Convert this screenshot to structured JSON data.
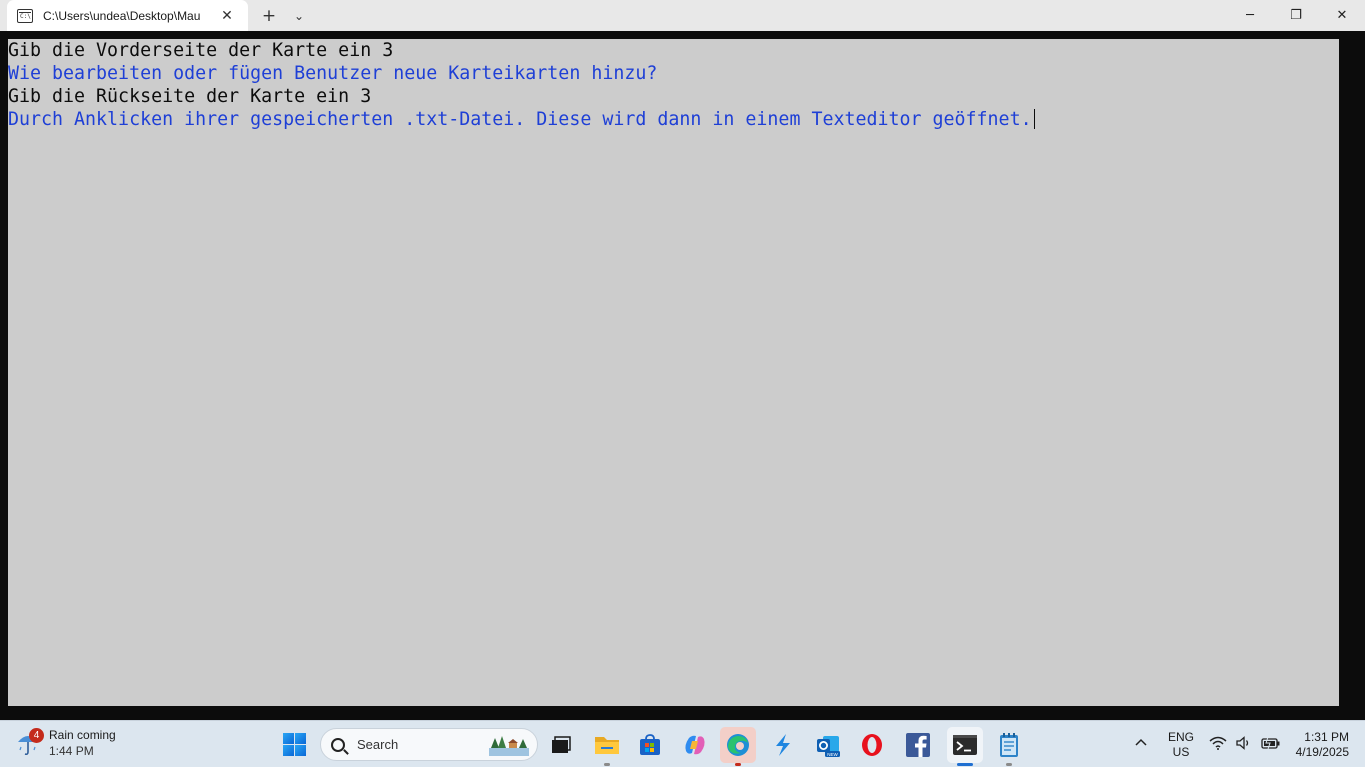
{
  "window": {
    "tab_title": "C:\\Users\\undea\\Desktop\\Mau",
    "tab_icon_text": "C:\\",
    "close_tab_glyph": "✕",
    "new_tab_glyph": "+",
    "dropdown_glyph": "⌄",
    "minimize_glyph": "─",
    "maximize_glyph": "❐",
    "close_glyph": "✕"
  },
  "console": {
    "lines": [
      {
        "text": "Gib die Vorderseite der Karte ein 3",
        "color": "#0c0c0c"
      },
      {
        "text": "Wie bearbeiten oder fügen Benutzer neue Karteikarten hinzu?",
        "color": "#1e3fd6"
      },
      {
        "text": "Gib die Rückseite der Karte ein 3",
        "color": "#0c0c0c"
      },
      {
        "text": "Durch Anklicken ihrer gespeicherten .txt-Datei. Diese wird dann in einem Texteditor geöffnet.",
        "color": "#1e3fd6"
      }
    ]
  },
  "taskbar": {
    "weather": {
      "badge": "4",
      "title": "Rain coming",
      "time": "1:44 PM",
      "icon": "umbrella-icon"
    },
    "search_label": "Search",
    "apps": [
      {
        "name": "task-view",
        "icon": "task-view-icon"
      },
      {
        "name": "file-explorer",
        "icon": "folder-icon"
      },
      {
        "name": "microsoft-store",
        "icon": "store-icon"
      },
      {
        "name": "copilot",
        "icon": "copilot-icon"
      },
      {
        "name": "edge",
        "icon": "edge-icon"
      },
      {
        "name": "visual-studio",
        "icon": "vs-icon"
      },
      {
        "name": "outlook-new",
        "icon": "outlook-icon"
      },
      {
        "name": "opera",
        "icon": "opera-icon"
      },
      {
        "name": "facebook",
        "icon": "facebook-icon"
      },
      {
        "name": "terminal",
        "icon": "terminal-icon"
      },
      {
        "name": "notepad",
        "icon": "notepad-icon"
      }
    ],
    "tray": {
      "chevron": "^",
      "lang_top": "ENG",
      "lang_bottom": "US",
      "clock_time": "1:31 PM",
      "clock_date": "4/19/2025"
    }
  }
}
